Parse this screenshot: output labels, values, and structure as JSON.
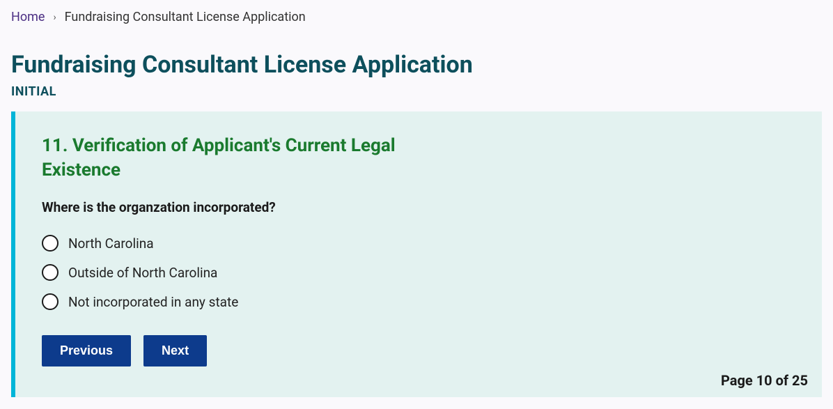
{
  "breadcrumb": {
    "home": "Home",
    "current": "Fundraising Consultant License Application"
  },
  "header": {
    "title": "Fundraising Consultant License Application",
    "subtitle": "INITIAL"
  },
  "form": {
    "section_title": "11. Verification of Applicant's Current Legal Existence",
    "question": "Where is the organzation incorporated?",
    "options": [
      "North Carolina",
      "Outside of North Carolina",
      "Not incorporated in any state"
    ],
    "buttons": {
      "previous": "Previous",
      "next": "Next"
    },
    "page_indicator": "Page 10 of 25"
  }
}
